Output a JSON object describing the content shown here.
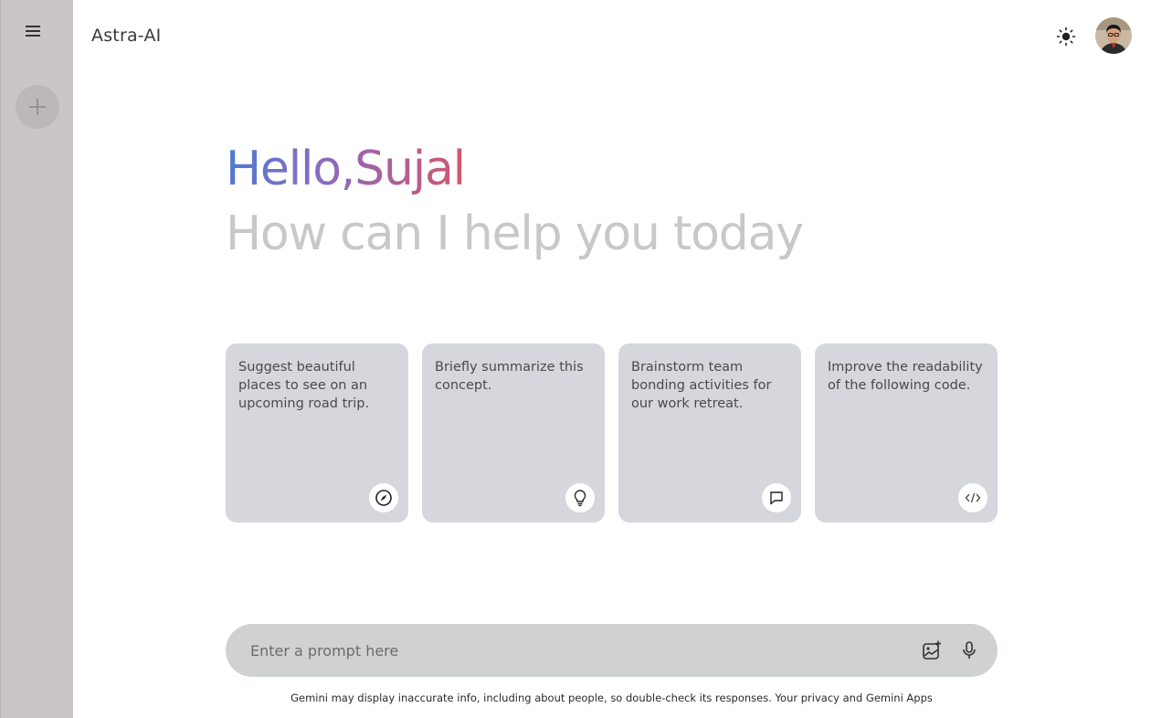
{
  "app": {
    "title": "Astra-AI"
  },
  "sidebar": {
    "menu_icon": "hamburger-menu-icon",
    "new_chat_icon": "plus-icon"
  },
  "header": {
    "theme_icon": "sun-icon",
    "avatar_icon": "user-avatar"
  },
  "greeting": {
    "hello": "Hello,Sujal",
    "subtitle": "How can I help you today"
  },
  "suggestions": [
    {
      "text": "Suggest beautiful places to see on an upcoming road trip.",
      "icon": "compass-icon"
    },
    {
      "text": "Briefly summarize this concept.",
      "icon": "lightbulb-icon"
    },
    {
      "text": "Brainstorm team bonding activities for our work retreat.",
      "icon": "message-icon"
    },
    {
      "text": "Improve the readability of the following code.",
      "icon": "code-icon"
    }
  ],
  "prompt": {
    "placeholder": "Enter a prompt here",
    "value": "",
    "gallery_icon": "image-add-icon",
    "mic_icon": "microphone-icon"
  },
  "footer": {
    "disclaimer": "Gemini may display inaccurate info, including about people, so double-check its responses. Your privacy and Gemini Apps"
  },
  "colors": {
    "sidebar_bg": "#cbc6c6",
    "card_bg": "#d5d7dc",
    "prompt_bg": "#d0d2d2",
    "gradient_start": "#4f7ad3",
    "gradient_end": "#d4556b",
    "subtitle": "#c8c8c8"
  }
}
